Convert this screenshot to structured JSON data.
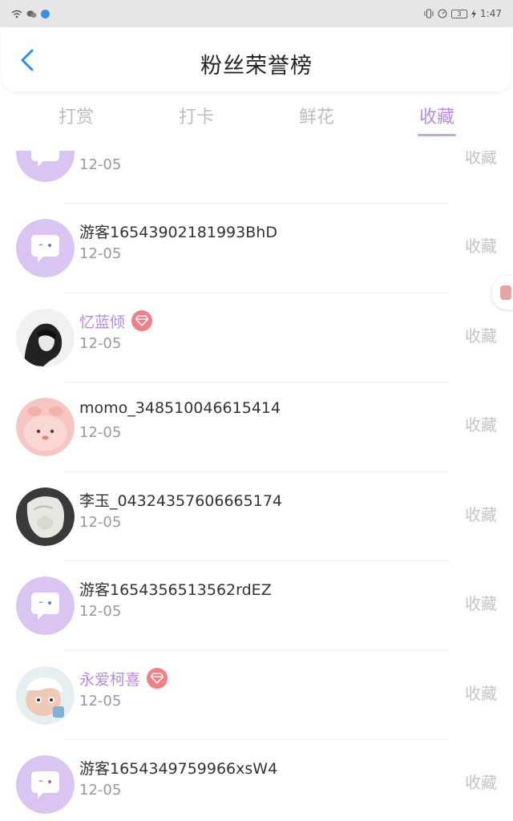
{
  "statusbar": {
    "time": "1:47",
    "battery": "3"
  },
  "header": {
    "title": "粉丝荣誉榜",
    "back_icon": "chevron-left-icon"
  },
  "tabs": [
    {
      "label": "打赏",
      "active": false
    },
    {
      "label": "打卡",
      "active": false
    },
    {
      "label": "鲜花",
      "active": false
    },
    {
      "label": "收藏",
      "active": true
    }
  ],
  "colors": {
    "accent": "#b88be0",
    "badge": "#f07f86",
    "muted": "#999999",
    "placeholder_avatar": "#d9c4f2"
  },
  "list": [
    {
      "name": "",
      "date": "12-05",
      "action": "收藏",
      "vip": false,
      "avatar": "default-chat-avatar"
    },
    {
      "name": "游客1654390218199​3BhD",
      "date": "12-05",
      "action": "收藏",
      "vip": false,
      "avatar": "default-chat-avatar"
    },
    {
      "name": "忆蓝倾",
      "date": "12-05",
      "action": "收藏",
      "vip": true,
      "avatar": "user-photo-avatar"
    },
    {
      "name": "momo_348510046615414",
      "date": "12-05",
      "action": "收藏",
      "vip": false,
      "avatar": "user-photo-avatar"
    },
    {
      "name": "李玉_04324357606665174",
      "date": "12-05",
      "action": "收藏",
      "vip": false,
      "avatar": "user-photo-avatar"
    },
    {
      "name": "游客1654356513562rdEZ",
      "date": "12-05",
      "action": "收藏",
      "vip": false,
      "avatar": "default-chat-avatar"
    },
    {
      "name": "永爱柯喜",
      "date": "12-05",
      "action": "收藏",
      "vip": true,
      "avatar": "user-photo-avatar"
    },
    {
      "name": "游客1654349759966xsW4",
      "date": "12-05",
      "action": "收藏",
      "vip": false,
      "avatar": "default-chat-avatar"
    }
  ]
}
